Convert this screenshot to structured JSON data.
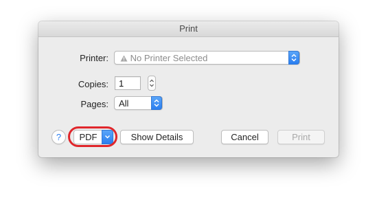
{
  "window": {
    "title": "Print"
  },
  "printer": {
    "label": "Printer:",
    "value": "No Printer Selected",
    "status_icon": "warning-icon"
  },
  "copies": {
    "label": "Copies:",
    "value": "1"
  },
  "pages": {
    "label": "Pages:",
    "value": "All"
  },
  "buttons": {
    "help": "?",
    "pdf": "PDF",
    "show_details": "Show Details",
    "cancel": "Cancel",
    "print": "Print"
  },
  "colors": {
    "accent": "#2a7ef0",
    "highlight": "#e0262b",
    "dialog_bg": "#ececec"
  }
}
